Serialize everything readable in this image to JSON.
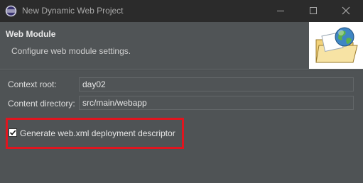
{
  "window": {
    "title": "New Dynamic Web Project",
    "app_icon": "eclipse-icon",
    "controls": [
      "minimize-icon",
      "maximize-icon",
      "close-icon"
    ]
  },
  "header": {
    "title": "Web Module",
    "description": "Configure web module settings.",
    "banner_icon": "folder-globe-icon"
  },
  "form": {
    "context_root_label": "Context root:",
    "context_root_value": "day02",
    "content_directory_label": "Content directory:",
    "content_directory_value": "src/main/webapp",
    "generate_descriptor_label": "Generate web.xml deployment descriptor",
    "generate_descriptor_checked": true
  },
  "annotation": {
    "highlight_color": "#e0151f"
  }
}
